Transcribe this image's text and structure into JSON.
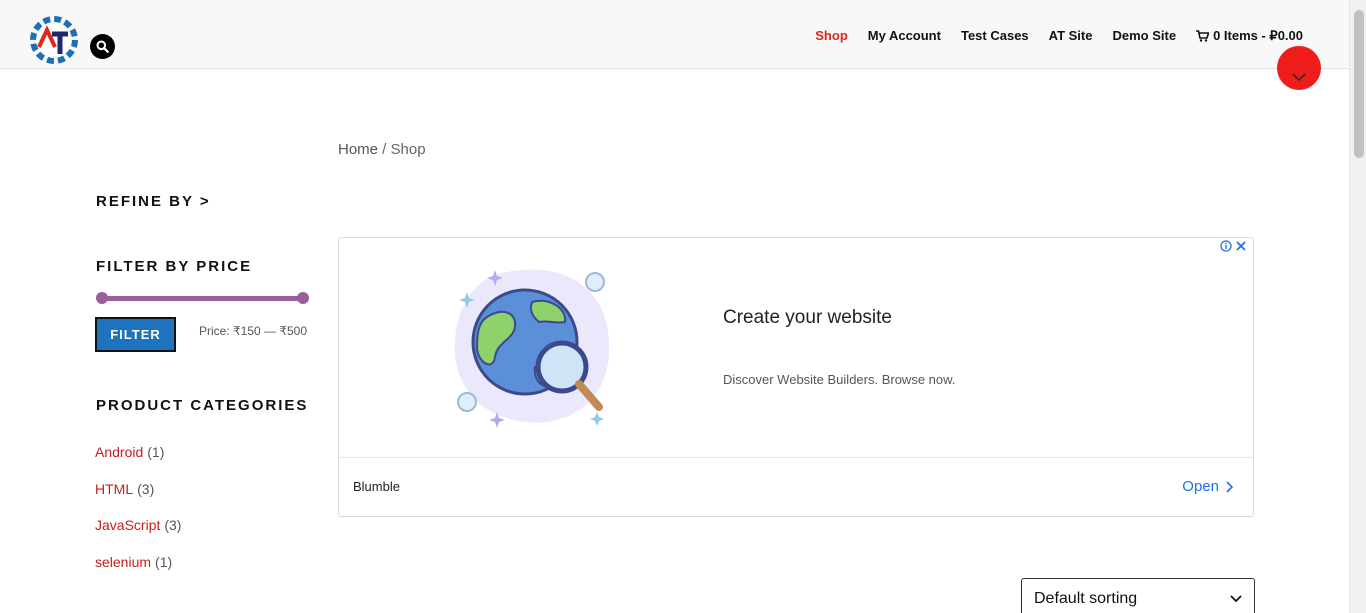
{
  "header": {
    "nav": [
      {
        "label": "Shop",
        "active": true
      },
      {
        "label": "My Account"
      },
      {
        "label": "Test Cases"
      },
      {
        "label": "AT Site"
      },
      {
        "label": "Demo Site"
      }
    ],
    "cart_label": "0 Items - ₽0.00",
    "accent_color": "#e1251b"
  },
  "breadcrumb": {
    "home": "Home",
    "separator": " / ",
    "current": "Shop"
  },
  "sidebar": {
    "refine_heading": "REFINE BY >",
    "price_heading": "FILTER BY PRICE",
    "filter_button": "FILTER",
    "price_text": "Price: ₹150 — ₹500",
    "price_min": 150,
    "price_max": 500,
    "categories_heading": "PRODUCT CATEGORIES",
    "categories": [
      {
        "name": "Android",
        "count": "(1)"
      },
      {
        "name": "HTML",
        "count": "(3)"
      },
      {
        "name": "JavaScript",
        "count": "(3)"
      },
      {
        "name": "selenium",
        "count": "(1)"
      }
    ]
  },
  "ad": {
    "title": "Create your website",
    "description": "Discover Website Builders. Browse now.",
    "brand": "Blumble",
    "cta": "Open"
  },
  "sorting": {
    "selected": "Default sorting"
  }
}
